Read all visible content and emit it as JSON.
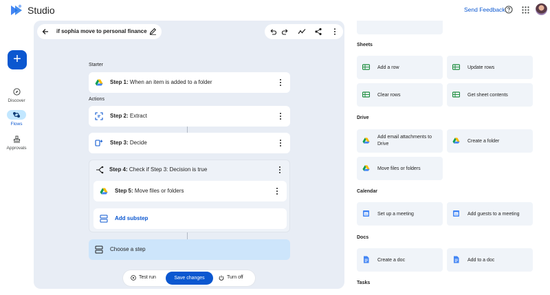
{
  "app": {
    "title": "Studio",
    "send_feedback": "Send Feedback"
  },
  "rail": {
    "create_label": "+",
    "items": [
      {
        "label": "Discover",
        "icon": "compass-icon",
        "active": false
      },
      {
        "label": "Flows",
        "icon": "flows-icon",
        "active": true
      },
      {
        "label": "Approvals",
        "icon": "approvals-icon",
        "active": false
      }
    ]
  },
  "flow": {
    "name": "if sophia move to personal finance",
    "starter_label": "Starter",
    "actions_label": "Actions",
    "steps": [
      {
        "number": "Step 1:",
        "text": " When an item is added to a folder",
        "icon": "drive-icon"
      },
      {
        "number": "Step 2:",
        "text": " Extract",
        "icon": "extract-icon"
      },
      {
        "number": "Step 3:",
        "text": " Decide",
        "icon": "decide-icon"
      },
      {
        "number": "Step 4:",
        "text": " Check if Step 3: Decision is true",
        "icon": "branch-icon"
      },
      {
        "number": "Step 5:",
        "text": " Move files or folders",
        "icon": "drive-icon"
      }
    ],
    "add_substep": "Add substep",
    "choose_step": "Choose a step"
  },
  "bottom_bar": {
    "test_run": "Test run",
    "save_changes": "Save changes",
    "turn_off": "Turn off"
  },
  "panel": {
    "sections": [
      {
        "title": "Sheets",
        "items": [
          "Add a row",
          "Update rows",
          "Clear rows",
          "Get sheet contents"
        ]
      },
      {
        "title": "Drive",
        "items": [
          "Add email attachments to Drive",
          "Create a folder",
          "Move files or folders"
        ]
      },
      {
        "title": "Calendar",
        "items": [
          "Set up a meeting",
          "Add guests to a meeting"
        ]
      },
      {
        "title": "Docs",
        "items": [
          "Create a doc",
          "Add to a doc"
        ]
      },
      {
        "title": "Tasks",
        "items": []
      }
    ]
  },
  "colors": {
    "accent": "#0b57d0",
    "canvas_bg": "#e8edf5",
    "selected_step": "#cde5fb",
    "sheets_green": "#1e8e3e"
  }
}
